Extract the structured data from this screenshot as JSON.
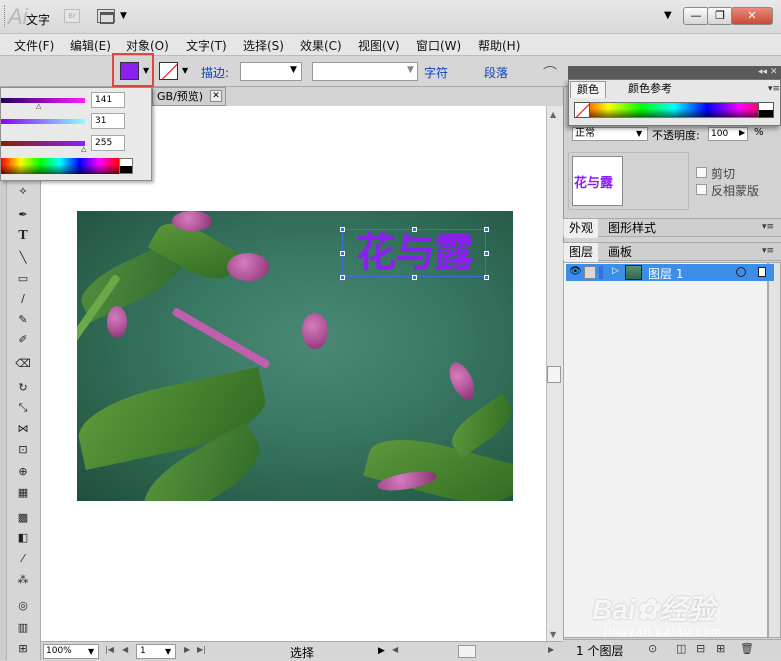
{
  "titlebar": {
    "logo": "Ai",
    "br": "Br",
    "min": "—",
    "max": "❐",
    "close": "✕"
  },
  "menu": [
    "文件(F)",
    "编辑(E)",
    "对象(O)",
    "文字(T)",
    "选择(S)",
    "效果(C)",
    "视图(V)",
    "窗口(W)",
    "帮助(H)"
  ],
  "control": {
    "label": "文字",
    "fill_color": "#8a1ff0",
    "stroke_label": "描边:",
    "char_link": "字符",
    "para_link": "段落"
  },
  "color_flyout": {
    "r": "141",
    "g": "31",
    "b": "255"
  },
  "document": {
    "tab": "GB/预览)"
  },
  "canvas": {
    "art_text": "花与露"
  },
  "status": {
    "zoom": "100%",
    "page": "1",
    "tool": "选择"
  },
  "color_panel": {
    "tab_color": "颜色",
    "tab_guide": "颜色参考"
  },
  "transparency": {
    "blend_mode": "正常",
    "opacity_label": "不透明度:",
    "opacity_value": "100",
    "opacity_unit": "%",
    "thumb_text": "花与露",
    "clip_label": "剪切",
    "invert_label": "反相蒙版"
  },
  "appearance_tabs": {
    "appearance": "外观",
    "graphic_styles": "图形样式"
  },
  "layers_tabs": {
    "layers": "图层",
    "artboards": "画板"
  },
  "layers": {
    "layer1": "图层 1",
    "count": "1 个图层"
  },
  "watermark": {
    "main": "Bai✿经验",
    "sub": "jingyan.baidu.com"
  }
}
